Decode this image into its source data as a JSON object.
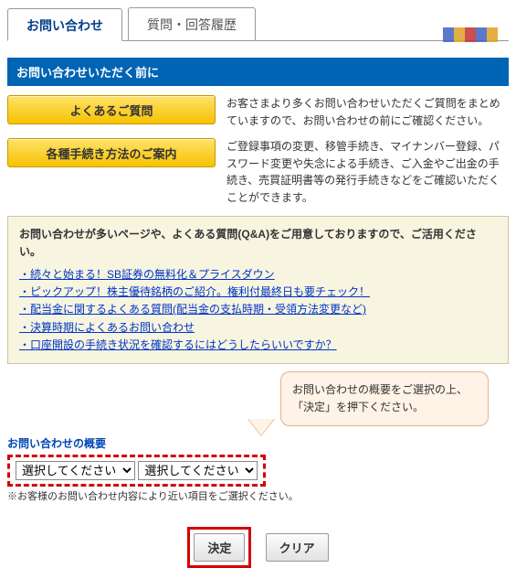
{
  "tabs": {
    "inquiry": "お問い合わせ",
    "history": "質問・回答履歴"
  },
  "sectionTitle": "お問い合わせいただく前に",
  "faq": {
    "btn": "よくあるご質問",
    "text": "お客さまより多くお問い合わせいただくご質問をまとめていますので、お問い合わせの前にご確認ください。"
  },
  "proc": {
    "btn": "各種手続き方法のご案内",
    "text": "ご登録事項の変更、移管手続き、マイナンバー登録、パスワード変更や失念による手続き、ご入金やご出金の手続き、売買証明書等の発行手続きなどをご確認いただくことができます。"
  },
  "info": {
    "title": "お問い合わせが多いページや、よくある質問(Q&A)をご用意しておりますので、ご活用ください。",
    "links": [
      "・続々と始まる！SB証券の無料化＆プライスダウン",
      "・ピックアップ！株主優待銘柄のご紹介。権利付最終日も要チェック！",
      "・配当金に関するよくある質問(配当金の支払時期・受領方法変更など)",
      "・決算時期によくあるお問い合わせ",
      "・口座開設の手続き状況を確認するにはどうしたらいいですか？"
    ]
  },
  "callout": {
    "l1": "お問い合わせの概要をご選択の上、",
    "l2": "「決定」を押下ください。"
  },
  "form": {
    "label": "お問い合わせの概要",
    "select1": "選択してください",
    "select2": "選択してください",
    "note": "※お客様のお問い合わせ内容により近い項目をご選択ください。"
  },
  "buttons": {
    "submit": "決定",
    "clear": "クリア"
  }
}
